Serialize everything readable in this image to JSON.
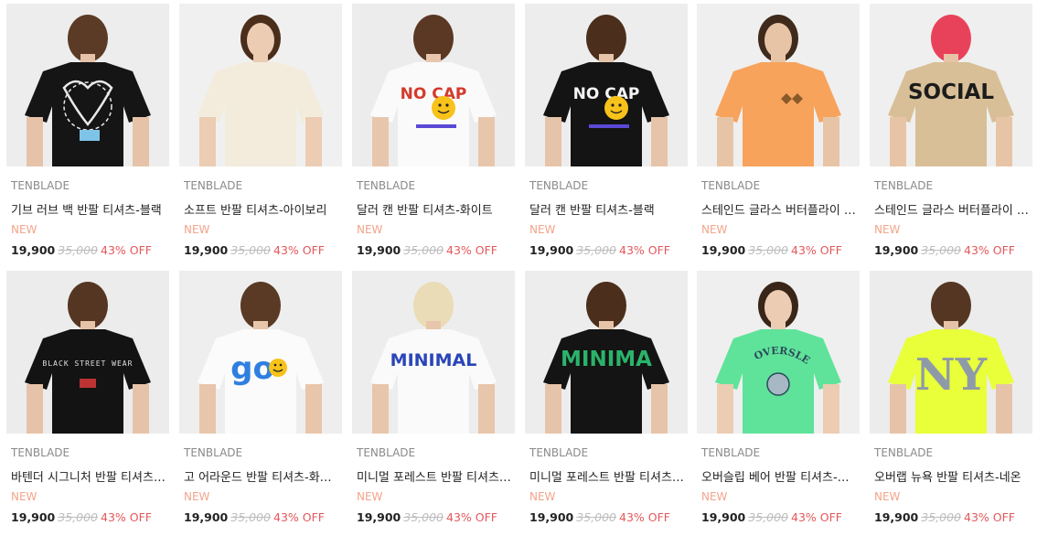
{
  "products": [
    {
      "brand": "TENBLADE",
      "name": "기브 러브 백 반팔 티셔츠-블랙",
      "badge": "NEW",
      "sale_price": "19,900",
      "original_price": "35,000",
      "discount": "43% OFF",
      "bg": "#ededed",
      "shirt": "#151515",
      "skin": "#e6c3a8",
      "hair": "#5b3b26",
      "print": "graffiti-heart",
      "print_color": "#e9e9e9",
      "print_text": "",
      "view": "back"
    },
    {
      "brand": "TENBLADE",
      "name": "소프트 반팔 티셔츠-아이보리",
      "badge": "NEW",
      "sale_price": "19,900",
      "original_price": "35,000",
      "discount": "43% OFF",
      "bg": "#f0f0f0",
      "shirt": "#f3ecdd",
      "skin": "#ecccb3",
      "hair": "#4a2e1b",
      "print": "",
      "print_color": "#f3ecdd",
      "print_text": "",
      "view": "front"
    },
    {
      "brand": "TENBLADE",
      "name": "달러 캔 반팔 티셔츠-화이트",
      "badge": "NEW",
      "sale_price": "19,900",
      "original_price": "35,000",
      "discount": "43% OFF",
      "bg": "#ececec",
      "shirt": "#fafafa",
      "skin": "#e8c6ab",
      "hair": "#5a3823",
      "print": "smiley-text",
      "print_color": "#d43a2b",
      "print_text": "NO CAP",
      "view": "back"
    },
    {
      "brand": "TENBLADE",
      "name": "달러 캔 반팔 티셔츠-블랙",
      "badge": "NEW",
      "sale_price": "19,900",
      "original_price": "35,000",
      "discount": "43% OFF",
      "bg": "#ededed",
      "shirt": "#141414",
      "skin": "#e6c4a9",
      "hair": "#4b2f1c",
      "print": "smiley-text",
      "print_color": "#f4f4f4",
      "print_text": "NO CAP",
      "view": "back"
    },
    {
      "brand": "TENBLADE",
      "name": "스테인드 글라스 버터플라이 반팔 티셔츠-오렌지",
      "badge": "NEW",
      "sale_price": "19,900",
      "original_price": "35,000",
      "discount": "43% OFF",
      "bg": "#efefef",
      "shirt": "#f7a35c",
      "skin": "#e8c4a6",
      "hair": "#3f2a1c",
      "print": "butterfly",
      "print_color": "#8a5a2b",
      "print_text": "",
      "view": "side"
    },
    {
      "brand": "TENBLADE",
      "name": "스테인드 글라스 버터플라이 반팔 티셔츠-베이지",
      "badge": "NEW",
      "sale_price": "19,900",
      "original_price": "35,000",
      "discount": "43% OFF",
      "bg": "#efefef",
      "shirt": "#d8bf97",
      "skin": "#e8c4a6",
      "hair": "#e8425a",
      "print": "text",
      "print_color": "#1c1c1c",
      "print_text": "SOCIAL",
      "view": "back"
    },
    {
      "brand": "TENBLADE",
      "name": "바텐더 시그니처 반팔 티셔츠-블랙",
      "badge": "NEW",
      "sale_price": "19,900",
      "original_price": "35,000",
      "discount": "43% OFF",
      "bg": "#ececec",
      "shirt": "#131313",
      "skin": "#e6c3a8",
      "hair": "#553622",
      "print": "small-text",
      "print_color": "#e0e0e0",
      "print_text": "BLACK STREET WEAR",
      "view": "back"
    },
    {
      "brand": "TENBLADE",
      "name": "고 어라운드 반팔 티셔츠-화이트",
      "badge": "NEW",
      "sale_price": "19,900",
      "original_price": "35,000",
      "discount": "43% OFF",
      "bg": "#eeeeee",
      "shirt": "#fbfbfb",
      "skin": "#e8c6ab",
      "hair": "#5a3925",
      "print": "go-smiley",
      "print_color": "#2f7fe0",
      "print_text": "go",
      "view": "back"
    },
    {
      "brand": "TENBLADE",
      "name": "미니멀 포레스트 반팔 티셔츠-화이트",
      "badge": "NEW",
      "sale_price": "19,900",
      "original_price": "35,000",
      "discount": "43% OFF",
      "bg": "#ededed",
      "shirt": "#fafafa",
      "skin": "#e8c6ab",
      "hair": "#e9dcb6",
      "print": "text",
      "print_color": "#2a45b8",
      "print_text": "MINIMAL",
      "view": "back"
    },
    {
      "brand": "TENBLADE",
      "name": "미니멀 포레스트 반팔 티셔츠-블랙",
      "badge": "NEW",
      "sale_price": "19,900",
      "original_price": "35,000",
      "discount": "43% OFF",
      "bg": "#ededed",
      "shirt": "#141414",
      "skin": "#e6c4a9",
      "hair": "#4b2f1c",
      "print": "text",
      "print_color": "#2bb36a",
      "print_text": "MINIMA",
      "view": "back"
    },
    {
      "brand": "TENBLADE",
      "name": "오버슬립 베어 반팔 티셔츠-민트",
      "badge": "NEW",
      "sale_price": "19,900",
      "original_price": "35,000",
      "discount": "43% OFF",
      "bg": "#efefef",
      "shirt": "#5fe39a",
      "skin": "#ecccb3",
      "hair": "#3a2618",
      "print": "bear",
      "print_color": "#2c4a5a",
      "print_text": "OVERSLEEP",
      "view": "front"
    },
    {
      "brand": "TENBLADE",
      "name": "오버랩 뉴욕 반팔 티셔츠-네온",
      "badge": "NEW",
      "sale_price": "19,900",
      "original_price": "35,000",
      "discount": "43% OFF",
      "bg": "#ececec",
      "shirt": "#e8ff3a",
      "skin": "#e6c3a8",
      "hair": "#553622",
      "print": "ny",
      "print_color": "#8f9aa8",
      "print_text": "NY",
      "view": "back"
    }
  ]
}
